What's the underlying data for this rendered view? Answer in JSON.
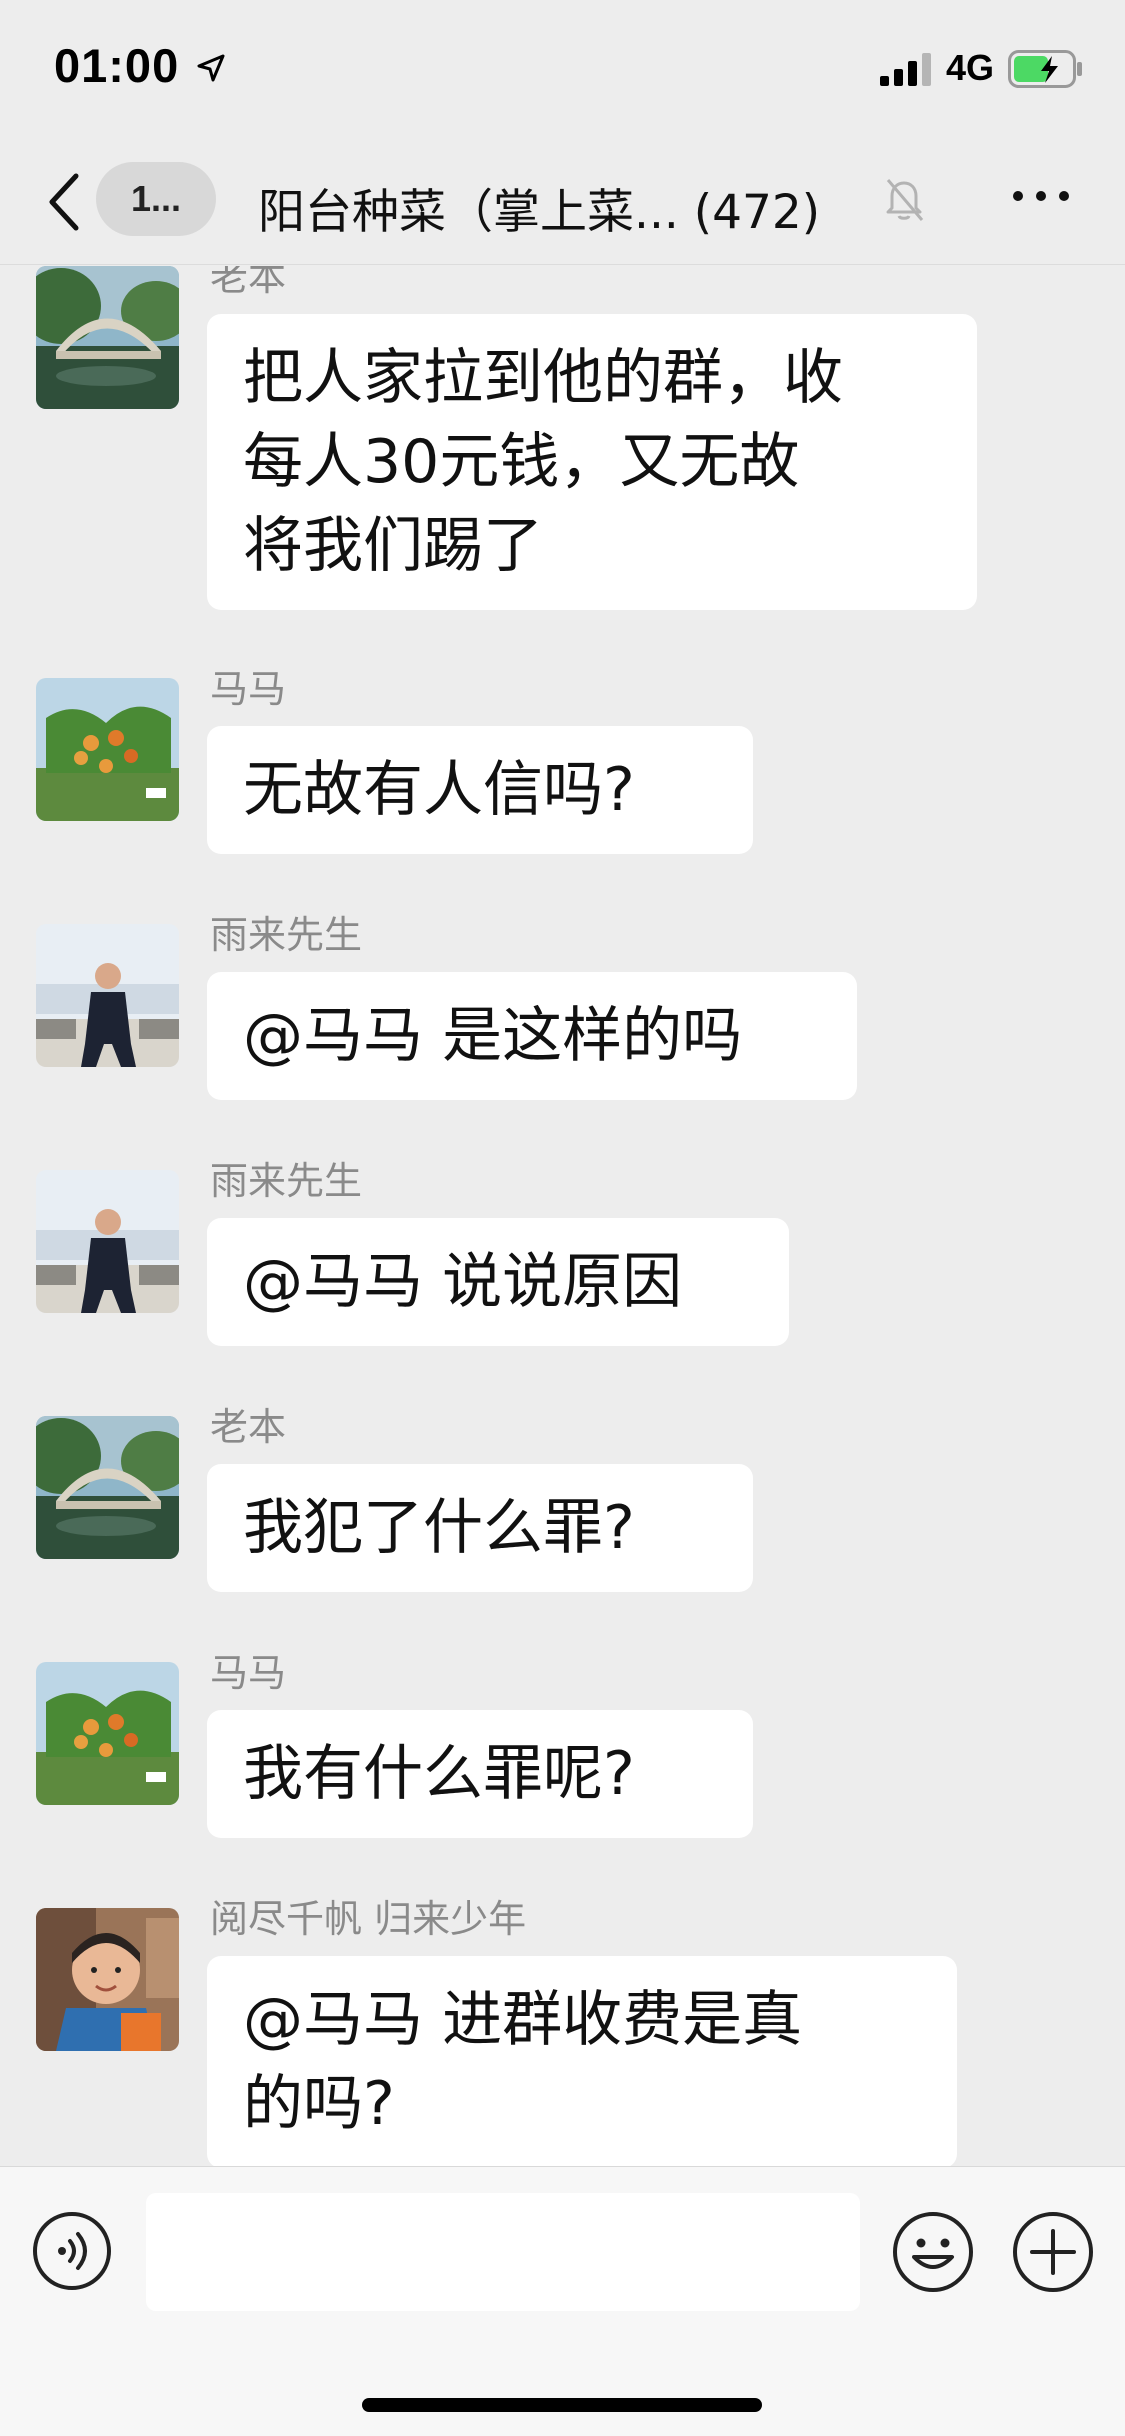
{
  "status_bar": {
    "time": "01:00",
    "network": "4G"
  },
  "nav": {
    "back_badge": "1...",
    "title": "阳台种菜（掌上菜... (472)"
  },
  "messages": [
    {
      "sender": "老本",
      "text": "把人家拉到他的群，收\n每人30元钱，又无故\n将我们踢了",
      "avatar": "bridge-avatar"
    },
    {
      "sender": "马马",
      "text": "无故有人信吗?",
      "avatar": "tomato-avatar"
    },
    {
      "sender": "雨来先生",
      "text": "@马马 是这样的吗",
      "avatar": "man-avatar"
    },
    {
      "sender": "雨来先生",
      "text": "@马马 说说原因",
      "avatar": "man-avatar"
    },
    {
      "sender": "老本",
      "text": "我犯了什么罪?",
      "avatar": "bridge-avatar"
    },
    {
      "sender": "马马",
      "text": "我有什么罪呢?",
      "avatar": "tomato-avatar"
    },
    {
      "sender": "阅尽千帆  归来少年",
      "text": "@马马  进群收费是真\n的吗?",
      "avatar": "child-avatar"
    }
  ],
  "input": {
    "placeholder": ""
  },
  "colors": {
    "background": "#ededed",
    "bubble": "#ffffff",
    "sender": "#8a8a8a",
    "battery_charge": "#4cd964"
  }
}
